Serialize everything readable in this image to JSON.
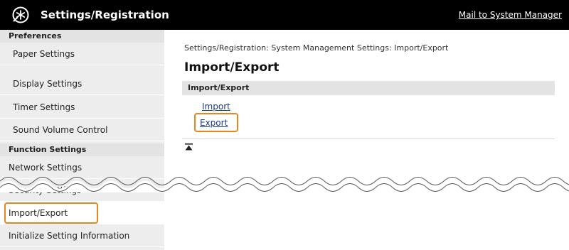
{
  "header": {
    "title": "Settings/Registration",
    "mail_link": "Mail to System Manager"
  },
  "sidebar": {
    "preferences_heading": "Preferences",
    "preferences_items": [
      {
        "label": "Paper Settings"
      },
      {
        "label": "Display Settings"
      },
      {
        "label": "Timer Settings"
      },
      {
        "label": "Sound Volume Control"
      }
    ],
    "function_heading": "Function Settings",
    "function_items": [
      {
        "label": "Network Settings"
      },
      {
        "label": "Security Settings"
      },
      {
        "label": "Import/Export"
      },
      {
        "label": "Initialize Setting Information"
      }
    ]
  },
  "main": {
    "breadcrumb": "Settings/Registration: System Management Settings: Import/Export",
    "page_title": "Import/Export",
    "section_title": "Import/Export",
    "links": [
      {
        "label": "Import"
      },
      {
        "label": "Export"
      }
    ]
  },
  "colors": {
    "highlight": "#e6871e",
    "link": "#1a3a8c",
    "topbar": "#000000",
    "sidebar": "#ededed"
  }
}
